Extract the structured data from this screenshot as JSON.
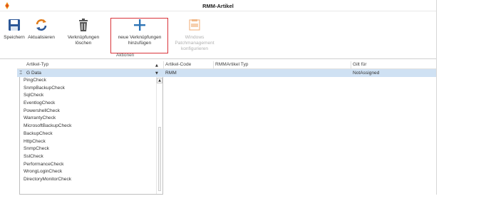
{
  "window": {
    "title": "RMM-Artikel"
  },
  "ribbon": {
    "buttons": [
      {
        "label": "Speichern",
        "icon": "save-icon",
        "color": "#2b5797"
      },
      {
        "label": "Aktualisieren",
        "icon": "refresh-icon",
        "color": "#e07b1a"
      },
      {
        "label": "Verknüpfungen löschen",
        "icon": "trash-icon",
        "color": "#555555"
      },
      {
        "label": "neue Verknüpfungen hinzufügen",
        "icon": "plus-icon",
        "color": "#2e75b6"
      },
      {
        "label": "Windows Patchmanagement konfigurieren",
        "icon": "patch-icon",
        "color": "#f2b98a"
      }
    ],
    "group_label": "Aktionen",
    "highlight_color": "#d9343a"
  },
  "grid": {
    "columns": [
      "Artikel-Typ",
      "Artikel-Code",
      "RMMArtikel Typ",
      "Gilt für"
    ],
    "filter_row": {
      "artikel_typ": "G Data",
      "artikel_code": "RMM",
      "rmm_artikel_typ": "",
      "gilt_fuer": "NotAssigned"
    },
    "filter_row_color": "#cfe1f3"
  },
  "dropdown": {
    "items": [
      "PingCheck",
      "SnmpBackupCheck",
      "SqlCheck",
      "EventlogCheck",
      "PowershellCheck",
      "WarrantyCheck",
      "MicrosoftBackupCheck",
      "BackupCheck",
      "HttpCheck",
      "SnmpCheck",
      "SslCheck",
      "PerformanceCheck",
      "WrongLoginCheck",
      "DirectoryMonitorCheck"
    ]
  }
}
